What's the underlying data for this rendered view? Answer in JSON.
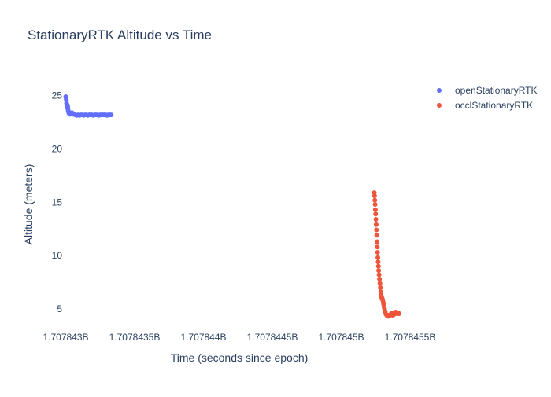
{
  "chart_data": {
    "type": "scatter",
    "title": "StationaryRTK Altitude vs Time",
    "xlabel": "Time (seconds since epoch)",
    "ylabel": "Altitude (meters)",
    "xlim": [
      1707842980,
      1707845540
    ],
    "ylim": [
      3.0,
      26.6
    ],
    "xticks": [
      1707843000,
      1707843500,
      1707844000,
      1707844500,
      1707845000,
      1707845500
    ],
    "xtick_labels": [
      "1.707843B",
      "1.7078435B",
      "1.707844B",
      "1.7078445B",
      "1.707845B",
      "1.7078455B"
    ],
    "yticks": [
      5,
      10,
      15,
      20,
      25
    ],
    "ytick_labels": [
      "5",
      "10",
      "15",
      "20",
      "25"
    ],
    "grid": false,
    "legend": "top-right",
    "series": [
      {
        "name": "openStationaryRTK",
        "color": "#636efa",
        "x": [
          1707843000,
          1707843002,
          1707843004,
          1707843006,
          1707843008,
          1707843010,
          1707843012,
          1707843014,
          1707843016,
          1707843018,
          1707843020,
          1707843022,
          1707843024,
          1707843028,
          1707843032,
          1707843036,
          1707843040,
          1707843045,
          1707843050,
          1707843055,
          1707843060,
          1707843070,
          1707843080,
          1707843090,
          1707843100,
          1707843110,
          1707843120,
          1707843130,
          1707843140,
          1707843150,
          1707843160,
          1707843170,
          1707843180,
          1707843190,
          1707843200,
          1707843210,
          1707843220,
          1707843230,
          1707843240,
          1707843250,
          1707843260,
          1707843270,
          1707843280,
          1707843290,
          1707843300,
          1707843310,
          1707843320,
          1707843330
        ],
        "y": [
          24.9,
          24.8,
          24.6,
          24.3,
          24.0,
          23.9,
          24.1,
          24.0,
          23.8,
          23.6,
          23.5,
          23.4,
          23.35,
          23.3,
          23.25,
          23.3,
          23.35,
          23.4,
          23.3,
          23.25,
          23.3,
          23.2,
          23.15,
          23.2,
          23.15,
          23.2,
          23.2,
          23.15,
          23.2,
          23.2,
          23.15,
          23.2,
          23.2,
          23.2,
          23.15,
          23.2,
          23.2,
          23.2,
          23.15,
          23.2,
          23.2,
          23.2,
          23.2,
          23.2,
          23.15,
          23.2,
          23.2,
          23.2
        ]
      },
      {
        "name": "occlStationaryRTK",
        "color": "#ef553b",
        "x": [
          1707845240,
          1707845242,
          1707845244,
          1707845246,
          1707845248,
          1707845250,
          1707845252,
          1707845254,
          1707845256,
          1707845258,
          1707845260,
          1707845262,
          1707845264,
          1707845266,
          1707845268,
          1707845270,
          1707845272,
          1707845275,
          1707845278,
          1707845281,
          1707845284,
          1707845287,
          1707845290,
          1707845293,
          1707845296,
          1707845299,
          1707845302,
          1707845305,
          1707845308,
          1707845312,
          1707845316,
          1707845320,
          1707845325,
          1707845330,
          1707845335,
          1707845340,
          1707845345,
          1707845350,
          1707845355,
          1707845360,
          1707845365,
          1707845370,
          1707845375,
          1707845380,
          1707845385,
          1707845390,
          1707845395,
          1707845400,
          1707845405,
          1707845410,
          1707845415,
          1707845420
        ],
        "y": [
          15.9,
          15.6,
          15.2,
          14.8,
          14.3,
          13.9,
          13.4,
          12.9,
          12.4,
          11.9,
          11.3,
          10.8,
          10.3,
          9.8,
          9.4,
          9.0,
          8.6,
          8.2,
          7.8,
          7.4,
          7.0,
          6.6,
          6.3,
          6.1,
          6.0,
          5.9,
          5.8,
          5.6,
          5.4,
          5.1,
          4.9,
          4.7,
          4.5,
          4.4,
          4.35,
          4.3,
          4.4,
          4.35,
          4.4,
          4.5,
          4.6,
          4.5,
          4.4,
          4.45,
          4.5,
          4.6,
          4.7,
          4.6,
          4.55,
          4.6,
          4.6,
          4.55
        ]
      }
    ]
  }
}
